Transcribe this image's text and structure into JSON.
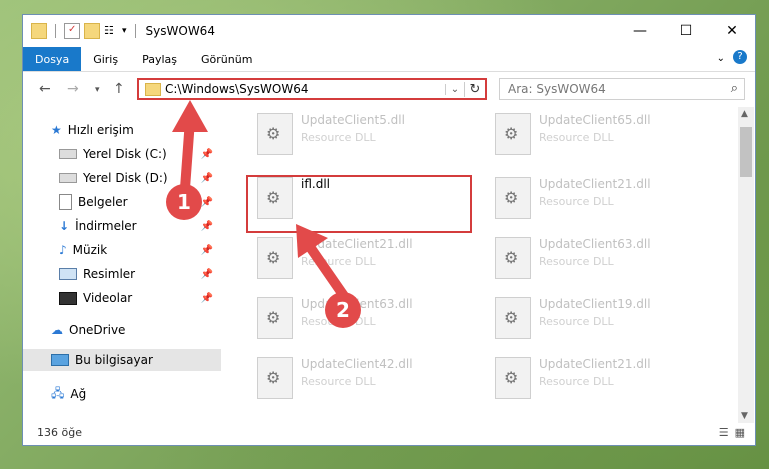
{
  "window": {
    "title": "SysWOW64"
  },
  "ribbon": {
    "tabs": [
      "Dosya",
      "Giriş",
      "Paylaş",
      "Görünüm"
    ]
  },
  "address": {
    "path": "C:\\Windows\\SysWOW64"
  },
  "search": {
    "placeholder": "Ara: SysWOW64"
  },
  "sidebar": {
    "items": [
      {
        "label": "Hızlı erişim",
        "icon": "star-icon"
      },
      {
        "label": "Yerel Disk (C:)",
        "icon": "drive-icon"
      },
      {
        "label": "Yerel Disk (D:)",
        "icon": "drive-icon"
      },
      {
        "label": "Belgeler",
        "icon": "documents-icon"
      },
      {
        "label": "İndirmeler",
        "icon": "download-icon"
      },
      {
        "label": "Müzik",
        "icon": "music-icon"
      },
      {
        "label": "Resimler",
        "icon": "pictures-icon"
      },
      {
        "label": "Videolar",
        "icon": "videos-icon"
      },
      {
        "label": "OneDrive",
        "icon": "cloud-icon"
      },
      {
        "label": "Bu bilgisayar",
        "icon": "computer-icon"
      },
      {
        "label": "Ağ",
        "icon": "network-icon"
      }
    ]
  },
  "files": [
    {
      "name": "UpdateClient5.dll",
      "type": "Resource DLL"
    },
    {
      "name": "UpdateClient65.dll",
      "type": "Resource DLL"
    },
    {
      "name": "ifl.dll"
    },
    {
      "name": "UpdateClient21.dll",
      "type": "Resource DLL"
    },
    {
      "name": "UpdateClient21.dll",
      "type": "Resource DLL"
    },
    {
      "name": "UpdateClient63.dll",
      "type": "Resource DLL"
    },
    {
      "name": "UpdateClient63.dll",
      "type": "Resource DLL"
    },
    {
      "name": "UpdateClient19.dll",
      "type": "Resource DLL"
    },
    {
      "name": "UpdateClient42.dll",
      "type": "Resource DLL"
    },
    {
      "name": "UpdateClient21.dll",
      "type": "Resource DLL"
    }
  ],
  "status": {
    "count": "136 öğe"
  },
  "annotations": [
    "1",
    "2"
  ],
  "colors": {
    "accent": "#1979ca",
    "highlight": "#d43c3c",
    "annotation": "#e24a4a"
  }
}
